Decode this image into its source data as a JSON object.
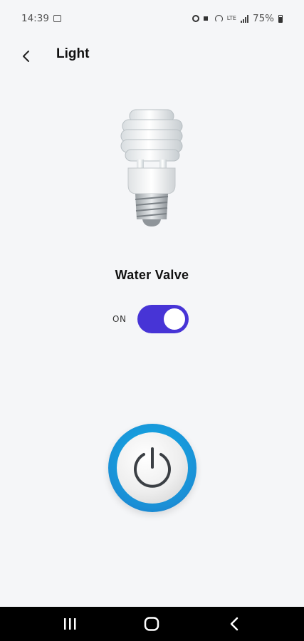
{
  "status_bar": {
    "time": "14:39",
    "battery": "75%",
    "network": "LTE"
  },
  "app_bar": {
    "title": "Light",
    "back_icon": "chevron-left-icon"
  },
  "device": {
    "image": "light-bulb-image",
    "name": "Water Valve",
    "toggle_label": "ON",
    "toggle_on": true,
    "accent_color": "#4734d6"
  },
  "power_button": {
    "icon": "power-icon",
    "ring_color": "#1b8fd6"
  },
  "nav_bar": {
    "recents_icon": "recents-icon",
    "home_icon": "home-icon",
    "back_icon": "back-icon"
  }
}
